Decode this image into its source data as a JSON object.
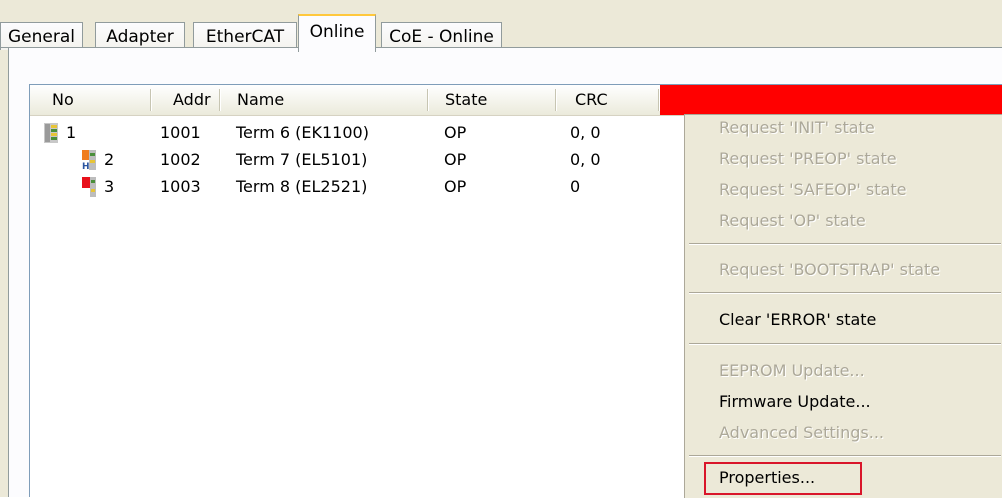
{
  "tabs": [
    "General",
    "Adapter",
    "EtherCAT",
    "Online",
    "CoE - Online"
  ],
  "active_tab": "Online",
  "columns": {
    "no": "No",
    "addr": "Addr",
    "name": "Name",
    "state": "State",
    "crc": "CRC"
  },
  "rows": [
    {
      "no": "1",
      "addr": "1001",
      "name": "Term 6 (EK1100)",
      "state": "OP",
      "crc": "0, 0"
    },
    {
      "no": "2",
      "addr": "1002",
      "name": "Term 7 (EL5101)",
      "state": "OP",
      "crc": "0, 0"
    },
    {
      "no": "3",
      "addr": "1003",
      "name": "Term 8 (EL2521)",
      "state": "OP",
      "crc": "0"
    }
  ],
  "menu": {
    "req_init": "Request 'INIT' state",
    "req_preop": "Request 'PREOP' state",
    "req_safeop": "Request 'SAFEOP' state",
    "req_op": "Request 'OP' state",
    "req_bootstrap": "Request 'BOOTSTRAP' state",
    "clear_error": "Clear 'ERROR' state",
    "eeprom_update": "EEPROM Update...",
    "firmware_update": "Firmware Update...",
    "advanced_settings": "Advanced Settings...",
    "properties": "Properties..."
  },
  "icons": {
    "row1": "coupler-icon",
    "row2": "encoder-terminal-icon",
    "row3": "output-terminal-icon"
  },
  "colors": {
    "highlight_border": "#d9162a",
    "header_red": "#ff0000",
    "active_tab_accent": "#ffc83c"
  }
}
